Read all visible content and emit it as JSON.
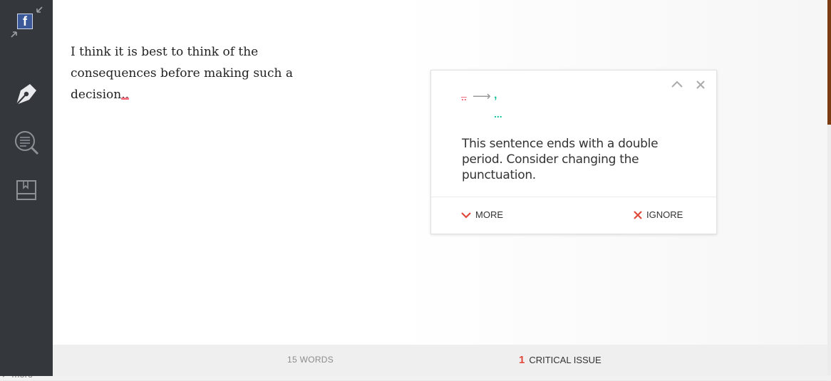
{
  "editor": {
    "text_before": "I think it is best to think of the consequences before making such a decision",
    "mistake": ".."
  },
  "card": {
    "from": "..",
    "arrow": "⟶",
    "to": ",",
    "to_alt": "...",
    "message": "This sentence ends with a double period. Consider changing the punctuation.",
    "more_label": "MORE",
    "ignore_label": "IGNORE"
  },
  "status": {
    "words": "15 WORDS",
    "issue_count": "1",
    "issue_label": "CRITICAL ISSUE"
  },
  "background": {
    "bottom_text": "more"
  },
  "colors": {
    "sidebar": "#34373c",
    "error": "#f26d7d",
    "suggestion": "#15c39a",
    "ignore_x": "#e0493b"
  },
  "icons": [
    "facebook-icon",
    "collapse-icon",
    "pen-icon",
    "review-icon",
    "book-icon",
    "chevron-up-icon",
    "close-icon",
    "chevron-down-icon",
    "x-icon"
  ]
}
